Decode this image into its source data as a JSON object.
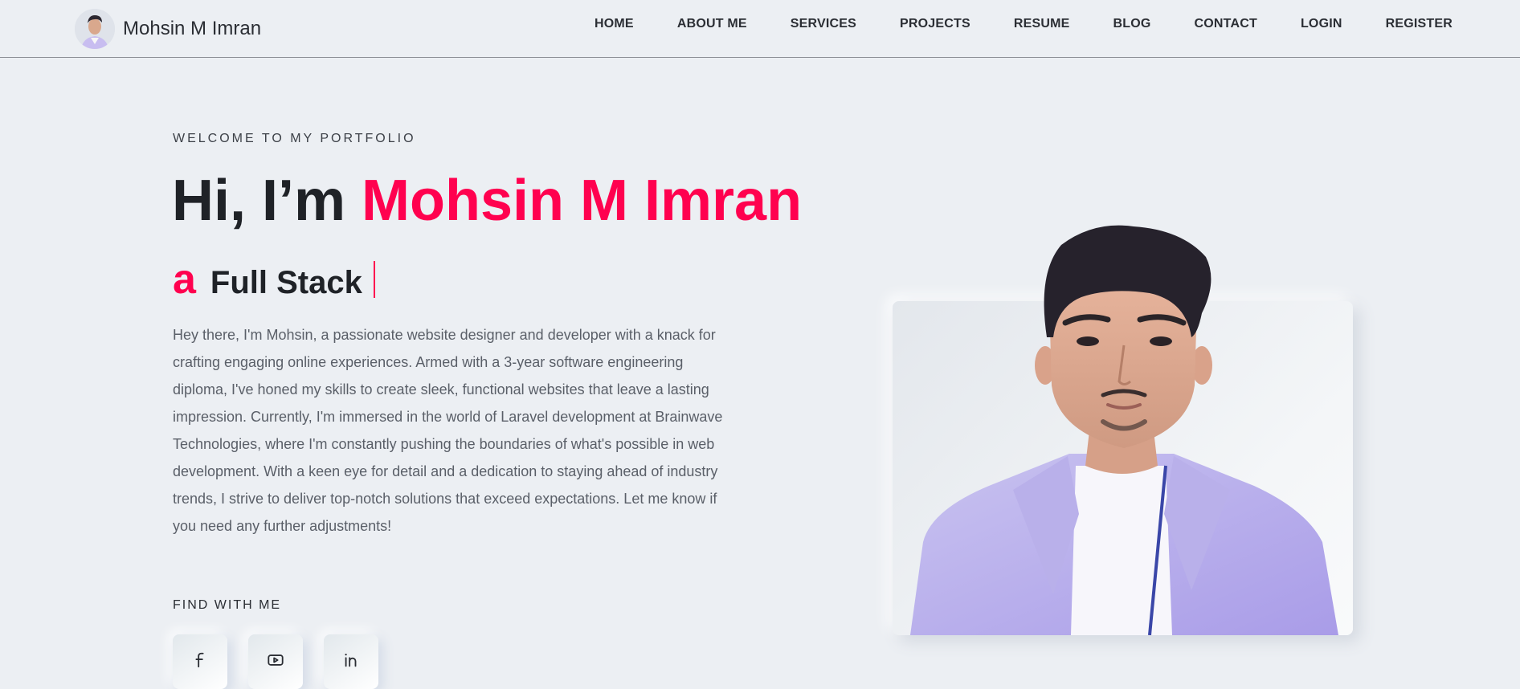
{
  "header": {
    "brand_name": "Mohsin M Imran",
    "nav": [
      "HOME",
      "ABOUT ME",
      "SERVICES",
      "PROJECTS",
      "RESUME",
      "BLOG",
      "CONTACT",
      "LOGIN",
      "REGISTER"
    ]
  },
  "hero": {
    "welcome": "WELCOME TO MY PORTFOLIO",
    "greeting": "Hi, I’m ",
    "name": "Mohsin M Imran",
    "article": "a",
    "role": "Full Stack",
    "bio": "Hey there, I'm Mohsin, a passionate website designer and developer with a knack for crafting engaging online experiences. Armed with a 3-year software engineering diploma, I've honed my skills to create sleek, functional websites that leave a lasting impression. Currently, I'm immersed in the world of Laravel development at Brainwave Technologies, where I'm constantly pushing the boundaries of what's possible in web development. With a keen eye for detail and a dedication to staying ahead of industry trends, I strive to deliver top-notch solutions that exceed expectations. Let me know if you need any further adjustments!"
  },
  "social": {
    "label": "FIND WITH ME",
    "icons": [
      "facebook-icon",
      "youtube-icon",
      "linkedin-icon"
    ]
  },
  "colors": {
    "accent": "#ff014f",
    "background": "#eceff3",
    "text": "#1f2227"
  }
}
